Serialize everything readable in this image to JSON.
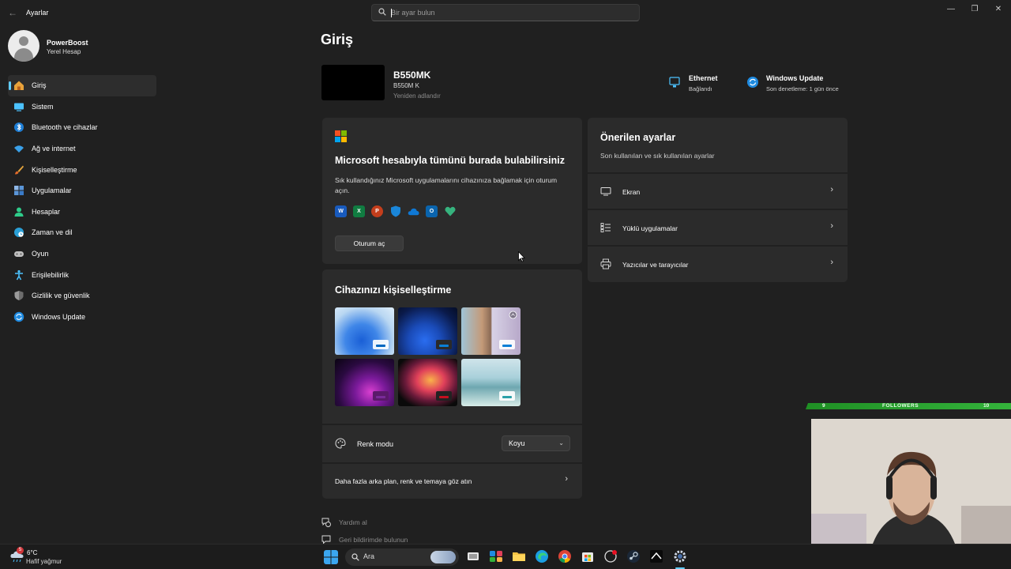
{
  "app": {
    "title": "Ayarlar",
    "back_glyph": "←",
    "window_controls": [
      "—",
      "❐",
      "✕"
    ]
  },
  "search": {
    "placeholder": "Bir ayar bulun",
    "value": ""
  },
  "profile": {
    "name": "PowerBoost",
    "account_type": "Yerel Hesap"
  },
  "sidebar": {
    "items": [
      {
        "label": "Giriş",
        "icon": "home-icon",
        "active": true
      },
      {
        "label": "Sistem",
        "icon": "system-icon"
      },
      {
        "label": "Bluetooth ve cihazlar",
        "icon": "bluetooth-icon"
      },
      {
        "label": "Ağ ve internet",
        "icon": "wifi-icon"
      },
      {
        "label": "Kişiselleştirme",
        "icon": "brush-icon"
      },
      {
        "label": "Uygulamalar",
        "icon": "apps-icon"
      },
      {
        "label": "Hesaplar",
        "icon": "account-icon"
      },
      {
        "label": "Zaman ve dil",
        "icon": "globe-clock-icon"
      },
      {
        "label": "Oyun",
        "icon": "gamepad-icon"
      },
      {
        "label": "Erişilebilirlik",
        "icon": "accessibility-icon"
      },
      {
        "label": "Gizlilik ve güvenlik",
        "icon": "shield-icon"
      },
      {
        "label": "Windows Update",
        "icon": "update-icon"
      }
    ]
  },
  "main": {
    "page_title": "Giriş",
    "device": {
      "name": "B550MK",
      "model": "B550M K",
      "rename_label": "Yeniden adlandır"
    },
    "status": {
      "ethernet": {
        "title": "Ethernet",
        "sub": "Bağlandı"
      },
      "update": {
        "title": "Windows Update",
        "sub": "Son denetleme: 1 gün önce"
      }
    },
    "ms_card": {
      "title": "Microsoft hesabıyla tümünü burada bulabilirsiniz",
      "description": "Sık kullandığınız Microsoft uygulamalarını cihazınıza bağlamak için oturum açın.",
      "apps": [
        {
          "name": "word-icon",
          "glyph": "W",
          "color": "#185abd"
        },
        {
          "name": "excel-icon",
          "glyph": "X",
          "color": "#107c41"
        },
        {
          "name": "powerpoint-icon",
          "glyph": "P",
          "color": "#c43e1c"
        },
        {
          "name": "defender-icon",
          "glyph": "",
          "color": "#1a86d9"
        },
        {
          "name": "onedrive-icon",
          "glyph": "",
          "color": "#0f78d4"
        },
        {
          "name": "outlook-icon",
          "glyph": "O",
          "color": "#0a64ad"
        },
        {
          "name": "family-icon",
          "glyph": "",
          "color": "#36b37e"
        }
      ],
      "signin_button": "Oturum aç"
    },
    "personalize": {
      "title": "Cihazınızı kişiselleştirme",
      "color_mode_label": "Renk modu",
      "color_mode_value": "Koyu",
      "more_link": "Daha fazla arka plan, renk ve temaya göz atın",
      "themes": [
        {
          "name": "windows-light-theme",
          "accent": "#0067c0"
        },
        {
          "name": "windows-dark-theme",
          "accent": "#0a7fd6"
        },
        {
          "name": "glow-theme",
          "accent": "#0a7fd6"
        },
        {
          "name": "captured-motion-theme",
          "accent": "#7a2a9a"
        },
        {
          "name": "flow-theme",
          "accent": "#c50f1f"
        },
        {
          "name": "sunrise-theme",
          "accent": "#2aa0a8"
        }
      ]
    },
    "recommended": {
      "title": "Önerilen ayarlar",
      "subtitle": "Son kullanılan ve sık kullanılan ayarlar",
      "items": [
        {
          "label": "Ekran",
          "icon": "monitor-icon"
        },
        {
          "label": "Yüklü uygulamalar",
          "icon": "list-icon"
        },
        {
          "label": "Yazıcılar ve tarayıcılar",
          "icon": "printer-icon"
        }
      ]
    },
    "help": {
      "get_help": "Yardım al",
      "feedback": "Geri bildirimde bulunun"
    }
  },
  "overlay": {
    "followers_label": "FOLLOWERS",
    "followers_current": "9",
    "followers_goal": "10"
  },
  "taskbar": {
    "weather_temp": "6°C",
    "weather_desc": "Hafif yağmur",
    "weather_badge": "5",
    "search_label": "Ara"
  },
  "colors": {
    "accent": "#60cdff",
    "background": "#202020",
    "card": "#2b2b2b"
  }
}
